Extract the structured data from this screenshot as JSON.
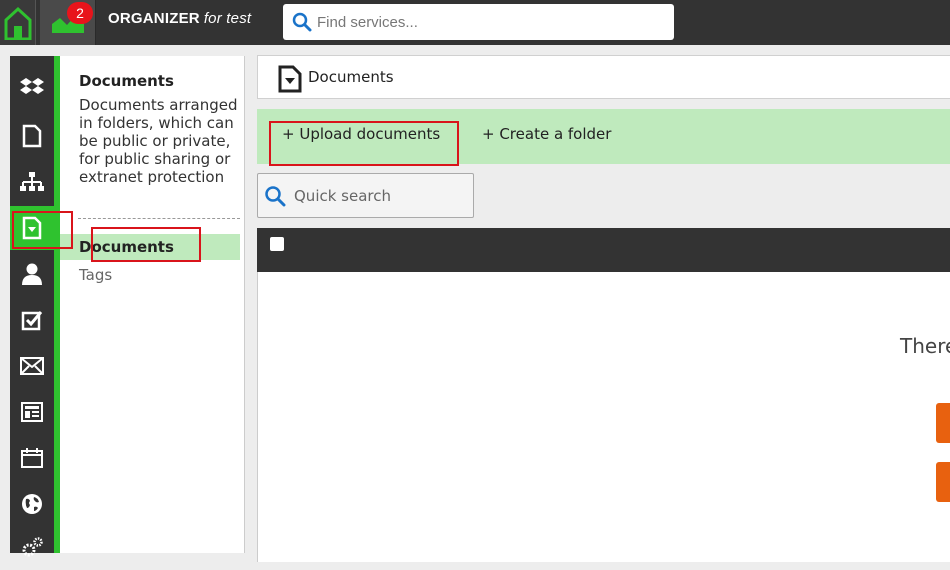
{
  "topbar": {
    "notification_count": "2",
    "brand_name": "ORGANIZER",
    "brand_suffix": "for test",
    "search_placeholder": "Find services..."
  },
  "leftnav": {
    "items": [
      "dropbox-icon",
      "file-icon",
      "sitemap-icon",
      "documents-icon",
      "user-icon",
      "checkbox-icon",
      "envelope-icon",
      "newspaper-icon",
      "calendar-icon",
      "globe-icon",
      "gears-icon"
    ],
    "active": "documents-icon"
  },
  "subpanel": {
    "title": "Documents",
    "description": "Documents arranged in folders, which can be public or private, for public sharing or extranet protection",
    "items": [
      {
        "label": "Documents",
        "active": true
      },
      {
        "label": "Tags",
        "active": false
      }
    ]
  },
  "main": {
    "header_title": "Documents",
    "actions": {
      "upload": "+ Upload documents",
      "create_folder": "+ Create a folder"
    },
    "quick_search_placeholder": "Quick search",
    "empty_text": "There"
  },
  "colors": {
    "accent_green": "#2fc22f",
    "light_green": "#bfeabd",
    "dark": "#333333",
    "orange": "#e8610f",
    "badge_red": "#e8141b",
    "highlight_red": "#d9141b"
  }
}
